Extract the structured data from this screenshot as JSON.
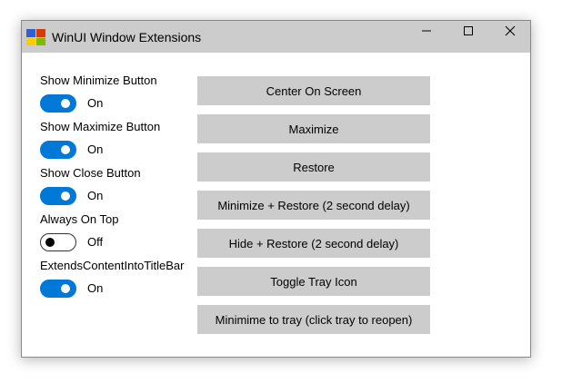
{
  "window": {
    "title": "WinUI Window Extensions",
    "app_icon_colors": [
      "#2f5fd0",
      "#d83b01",
      "#ffcc00",
      "#7fba00"
    ],
    "caption_buttons": [
      "minimize-icon",
      "maximize-icon",
      "close-icon"
    ]
  },
  "settings": [
    {
      "label": "Show Minimize Button",
      "state": "On",
      "on": true
    },
    {
      "label": "Show Maximize Button",
      "state": "On",
      "on": true
    },
    {
      "label": "Show Close Button",
      "state": "On",
      "on": true
    },
    {
      "label": "Always On Top",
      "state": "Off",
      "on": false
    },
    {
      "label": "ExtendsContentIntoTitleBar",
      "state": "On",
      "on": true
    }
  ],
  "actions": [
    {
      "label": "Center On Screen"
    },
    {
      "label": "Maximize"
    },
    {
      "label": "Restore"
    },
    {
      "label": "Minimize + Restore (2 second delay)"
    },
    {
      "label": "Hide + Restore (2 second delay)"
    },
    {
      "label": "Toggle Tray Icon"
    },
    {
      "label": "Minimime to tray (click tray to reopen)"
    }
  ],
  "colors": {
    "accent": "#0078d7",
    "titlebar": "#cccccc",
    "button": "#cccccc"
  }
}
